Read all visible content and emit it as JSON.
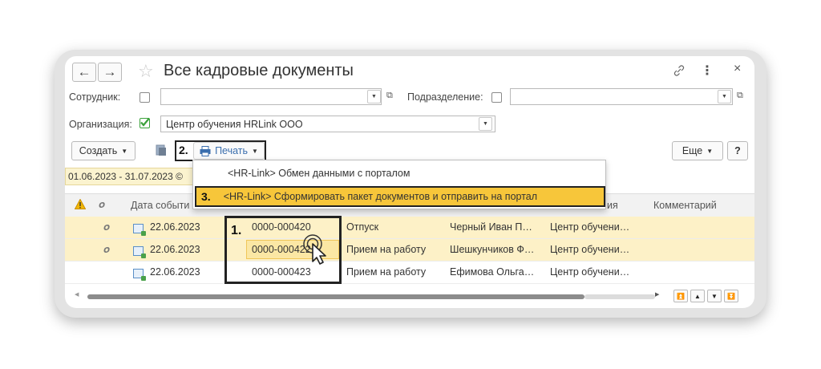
{
  "window": {
    "title": "Все кадровые документы",
    "back": "←",
    "forward": "→",
    "star": "☆",
    "link_icon": "link-icon",
    "more": "⋮",
    "close": "×"
  },
  "filters": {
    "employee_label": "Сотрудник:",
    "employee_value": "",
    "department_label": "Подразделение:",
    "department_value": "",
    "organization_label": "Организация:",
    "organization_checked": true,
    "organization_value": "Центр обучения HRLink ООО"
  },
  "toolbar": {
    "create_label": "Создать",
    "print_label": "Печать",
    "more_label": "Еще",
    "help_label": "?"
  },
  "period": "01.06.2023 - 31.07.2023",
  "period_suffix": "©",
  "steps": {
    "step1": "1.",
    "step2": "2.",
    "step3": "3."
  },
  "print_menu": {
    "items": [
      "<HR-Link> Обмен данными с порталом",
      "<HR-Link> Сформировать пакет документов и отправить на портал"
    ]
  },
  "table": {
    "headers": {
      "date": "Дата событи",
      "org_tail": "ия",
      "comment": "Комментарий"
    },
    "rows": [
      {
        "date": "22.06.2023",
        "number": "0000-000420",
        "type": "Отпуск",
        "employee": "Черный Иван П…",
        "org": "Центр обучени…",
        "comment": ""
      },
      {
        "date": "22.06.2023",
        "number": "0000-000422",
        "type": "Прием на работу",
        "employee": "Шешкунчиков Ф…",
        "org": "Центр обучени…",
        "comment": ""
      },
      {
        "date": "22.06.2023",
        "number": "0000-000423",
        "type": "Прием на работу",
        "employee": "Ефимова Ольга…",
        "org": "Центр обучени…",
        "comment": ""
      }
    ]
  },
  "colors": {
    "highlight_yellow": "#f5c518",
    "row_selected": "#fdf1c7",
    "check_green": "#3aa13a"
  }
}
